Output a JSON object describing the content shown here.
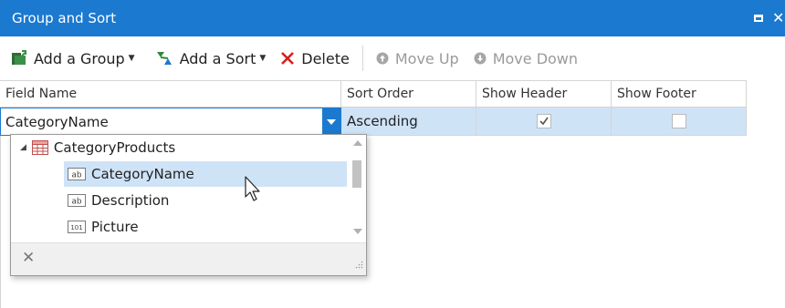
{
  "window": {
    "title": "Group and Sort"
  },
  "toolbar": {
    "add_group": "Add a Group",
    "add_sort": "Add a Sort",
    "delete": "Delete",
    "move_up": "Move Up",
    "move_down": "Move Down"
  },
  "grid": {
    "columns": [
      "Field Name",
      "Sort Order",
      "Show Header",
      "Show Footer"
    ],
    "row": {
      "field_name": "CategoryName",
      "sort_order": "Ascending",
      "show_header": true,
      "show_footer": false
    }
  },
  "dropdown": {
    "root": "CategoryProducts",
    "items": [
      {
        "label": "CategoryName",
        "type_icon": "ab",
        "highlighted": true
      },
      {
        "label": "Description",
        "type_icon": "ab",
        "highlighted": false
      },
      {
        "label": "Picture",
        "type_icon": "101",
        "highlighted": false
      }
    ]
  },
  "colors": {
    "accent": "#1b79cf",
    "selection": "#cfe3f7"
  }
}
